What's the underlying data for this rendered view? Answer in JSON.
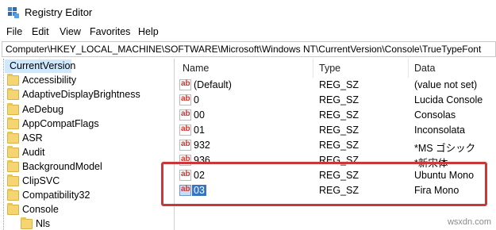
{
  "window": {
    "title": "Registry Editor"
  },
  "menu": [
    "File",
    "Edit",
    "View",
    "Favorites",
    "Help"
  ],
  "address": {
    "path": "Computer\\HKEY_LOCAL_MACHINE\\SOFTWARE\\Microsoft\\Windows NT\\CurrentVersion\\Console\\TrueTypeFont"
  },
  "tree": {
    "current": "CurrentVersion",
    "items": [
      "Accessibility",
      "AdaptiveDisplayBrightness",
      "AeDebug",
      "AppCompatFlags",
      "ASR",
      "Audit",
      "BackgroundModel",
      "ClipSVC",
      "Compatibility32",
      "Console",
      "Nls"
    ]
  },
  "list": {
    "columns": [
      "Name",
      "Type",
      "Data"
    ],
    "rows": [
      {
        "name": "(Default)",
        "type": "REG_SZ",
        "data": "(value not set)"
      },
      {
        "name": "0",
        "type": "REG_SZ",
        "data": "Lucida Console"
      },
      {
        "name": "00",
        "type": "REG_SZ",
        "data": "Consolas"
      },
      {
        "name": "01",
        "type": "REG_SZ",
        "data": "Inconsolata"
      },
      {
        "name": "932",
        "type": "REG_SZ",
        "data": "*MS ゴシック"
      },
      {
        "name": "936",
        "type": "REG_SZ",
        "data": "*新宋体"
      },
      {
        "name": "02",
        "type": "REG_SZ",
        "data": "Ubuntu Mono"
      },
      {
        "name": "03",
        "type": "REG_SZ",
        "data": "Fira Mono"
      }
    ],
    "selected_row": "03",
    "value_icon_text": "ab"
  },
  "colors": {
    "selection": "#3574c4",
    "highlight_box": "#c8373a",
    "tree_current": "#cde8ff",
    "folder": "#f5d472"
  },
  "watermark": "wsxdn.com"
}
